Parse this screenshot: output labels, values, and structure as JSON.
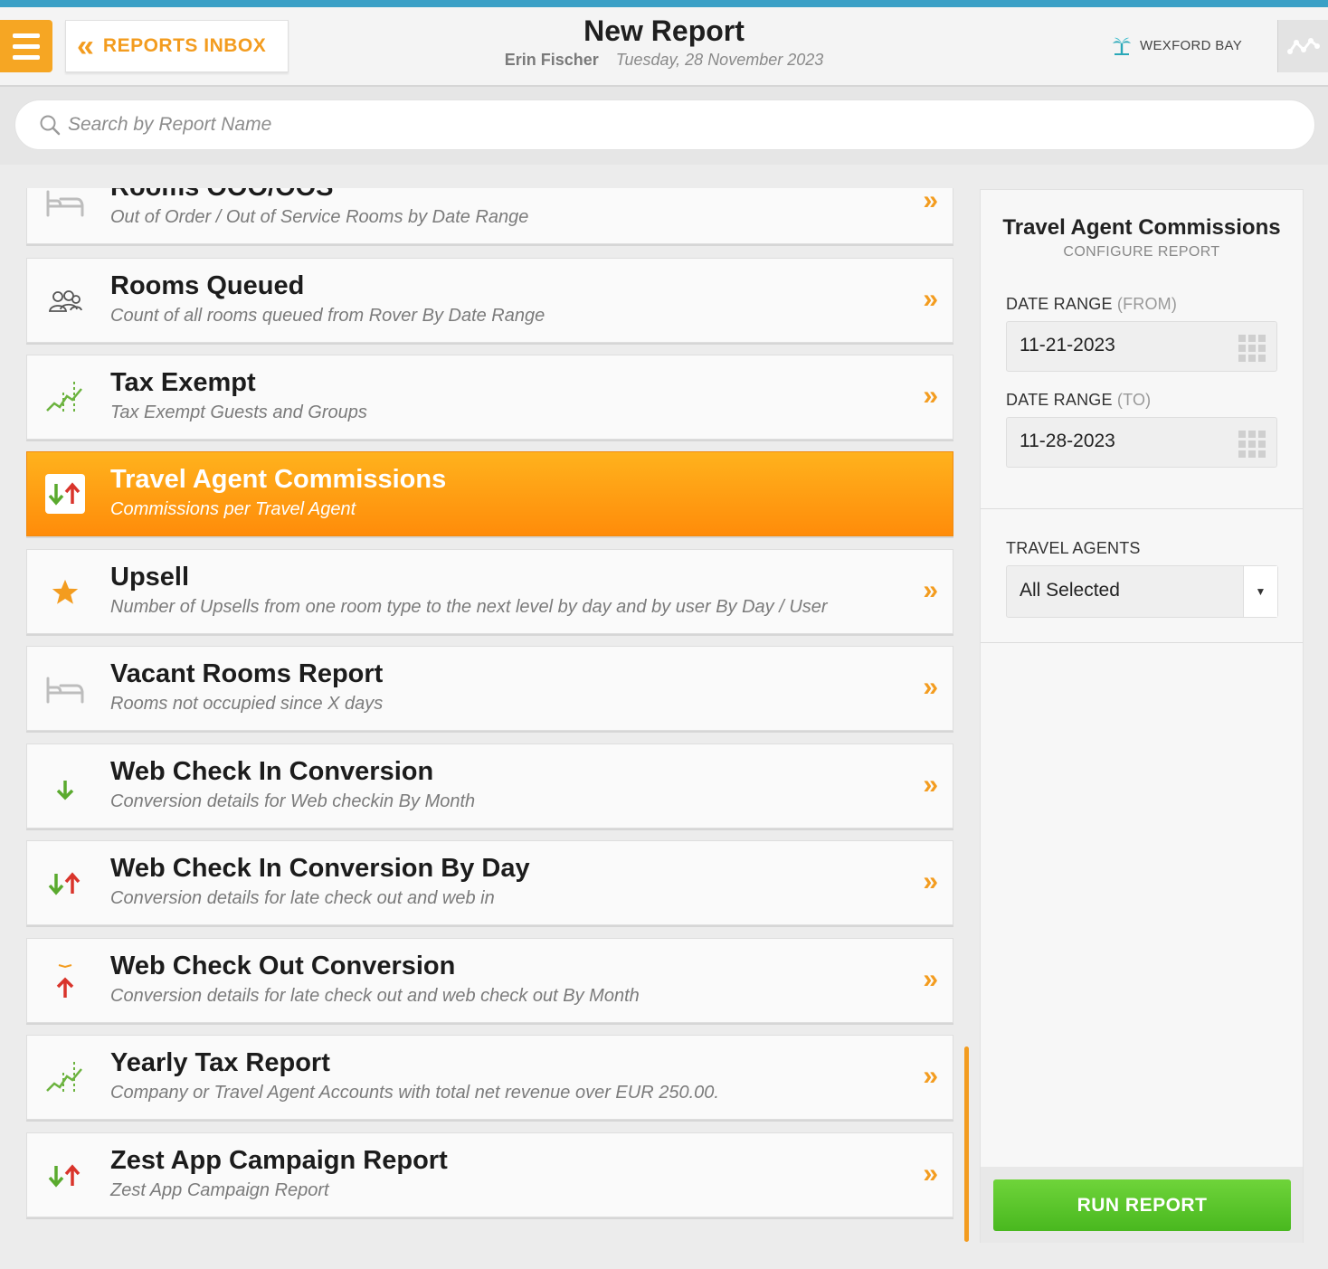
{
  "header": {
    "inbox_label": "REPORTS INBOX",
    "title": "New Report",
    "user": "Erin Fischer",
    "date": "Tuesday, 28 November 2023",
    "brand": "WEXFORD BAY"
  },
  "search": {
    "placeholder": "Search by Report Name"
  },
  "reports": [
    {
      "name": "Rooms OOO/OOS",
      "desc": "Out of Order / Out of Service Rooms by Date Range",
      "icon": "bed-icon"
    },
    {
      "name": "Rooms Queued",
      "desc": "Count of all rooms queued from Rover By Date Range",
      "icon": "users-icon"
    },
    {
      "name": "Tax Exempt",
      "desc": "Tax Exempt Guests and Groups",
      "icon": "trend-chart-icon"
    },
    {
      "name": "Travel Agent Commissions",
      "desc": "Commissions per Travel Agent",
      "icon": "up-down-arrows-icon",
      "active": true
    },
    {
      "name": "Upsell",
      "desc": "Number of Upsells from one room type to the next level by day and by user By Day / User",
      "icon": "star-icon"
    },
    {
      "name": "Vacant Rooms Report",
      "desc": "Rooms not occupied since X days",
      "icon": "bed-icon"
    },
    {
      "name": "Web Check In Conversion",
      "desc": "Conversion details for Web checkin By Month",
      "icon": "down-arrow-icon"
    },
    {
      "name": "Web Check In Conversion By Day",
      "desc": "Conversion details for late check out and web in",
      "icon": "up-down-arrows-icon"
    },
    {
      "name": "Web Check Out Conversion",
      "desc": "Conversion details for late check out and web check out By Month",
      "icon": "up-arrow-icon"
    },
    {
      "name": "Yearly Tax Report",
      "desc": "Company or Travel Agent Accounts with total net revenue over EUR 250.00.",
      "icon": "trend-chart-icon"
    },
    {
      "name": "Zest App Campaign Report",
      "desc": "Zest App Campaign Report",
      "icon": "up-down-arrows-icon"
    }
  ],
  "config": {
    "title": "Travel Agent Commissions",
    "subtitle": "CONFIGURE REPORT",
    "from_label": "DATE RANGE",
    "from_suffix": "(FROM)",
    "from_value": "11-21-2023",
    "to_label": "DATE RANGE",
    "to_suffix": "(TO)",
    "to_value": "11-28-2023",
    "agents_label": "TRAVEL AGENTS",
    "agents_value": "All Selected",
    "run_label": "RUN REPORT"
  },
  "colors": {
    "accent": "#f39c1f",
    "top_bar": "#3aa0c6",
    "run_button": "#49b81f",
    "arrow_down": "#5aaa2e",
    "arrow_up": "#d9342b"
  }
}
